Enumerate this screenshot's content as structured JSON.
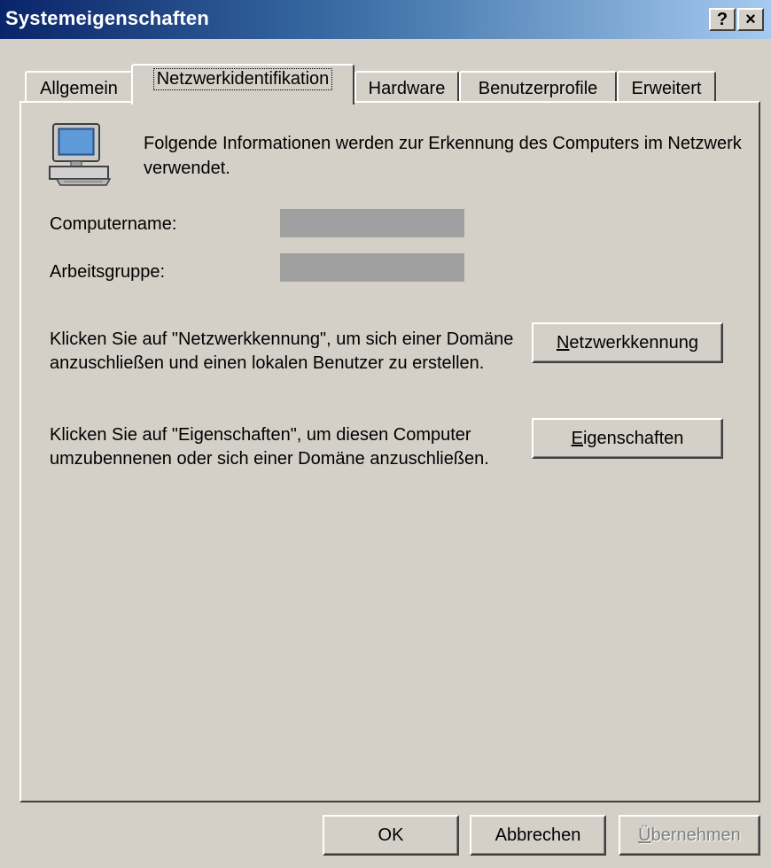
{
  "window": {
    "title": "Systemeigenschaften",
    "help_glyph": "?",
    "close_glyph": "×"
  },
  "tabs": [
    {
      "label": "Allgemein",
      "active": false
    },
    {
      "label": "Netzwerkidentifikation",
      "active": true
    },
    {
      "label": "Hardware",
      "active": false
    },
    {
      "label": "Benutzerprofile",
      "active": false
    },
    {
      "label": "Erweitert",
      "active": false
    }
  ],
  "panel": {
    "icon": "computer-icon",
    "info_text": "Folgende Informationen werden zur Erkennung des Computers im Netzwerk verwendet.",
    "computername_label": "Computername:",
    "computername_value": "",
    "arbeitsgruppe_label": "Arbeitsgruppe:",
    "arbeitsgruppe_value": "",
    "netzwerkkennung_desc": "Klicken Sie auf \"Netzwerkkennung\", um sich einer Domäne anzuschließen und einen lokalen Benutzer zu erstellen.",
    "netzwerkkennung_button": {
      "accel": "N",
      "rest": "etzwerkkennung"
    },
    "eigenschaften_desc": "Klicken Sie auf \"Eigenschaften\", um diesen Computer umzubennenen oder sich einer Domäne anzuschließen.",
    "eigenschaften_button": {
      "accel": "E",
      "rest": "igenschaften"
    }
  },
  "footer": {
    "ok_label": "OK",
    "cancel_label": "Abbrechen",
    "apply_button": {
      "accel": "Ü",
      "rest": "bernehmen",
      "disabled": true
    }
  },
  "colors": {
    "face": "#d4d0c8",
    "title_start": "#0a246a",
    "title_end": "#a6caf0",
    "redacted": "#a0a0a0"
  }
}
